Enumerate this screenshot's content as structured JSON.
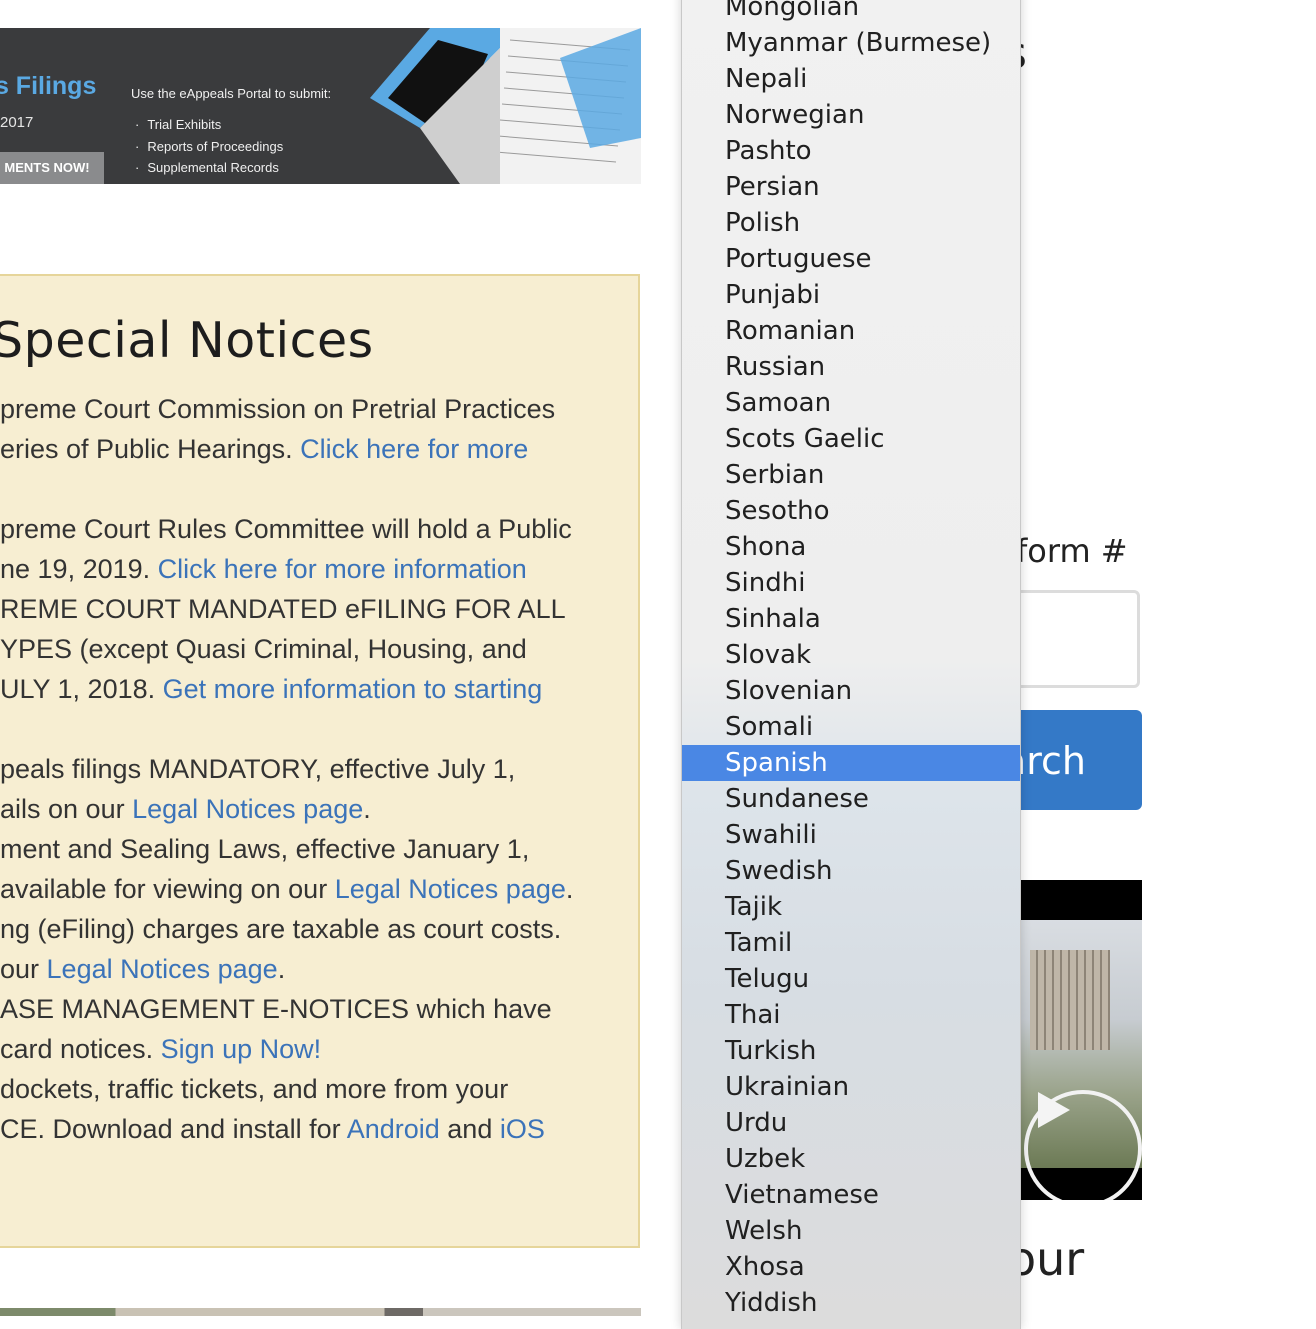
{
  "banner": {
    "title": "ls Filings",
    "year": "2017",
    "cta": "MENTS NOW!",
    "intro": "Use the eAppeals Portal to submit:",
    "items": [
      "Trial Exhibits",
      "Reports of Proceedings",
      "Supplemental Records"
    ]
  },
  "notices": {
    "heading": "Special Notices",
    "lines": [
      {
        "text": "preme Court Commission on Pretrial Practices",
        "link": ""
      },
      {
        "text": "eries of Public Hearings. ",
        "link": "Click here for more"
      },
      {
        "text": "preme Court Rules Committee will hold a Public",
        "link": ""
      },
      {
        "text": "ne 19, 2019. ",
        "link": "Click here for more information"
      },
      {
        "text": "REME COURT MANDATED eFILING FOR ALL",
        "link": ""
      },
      {
        "text": "YPES (except Quasi Criminal, Housing, and",
        "link": ""
      },
      {
        "text": "ULY 1, 2018. ",
        "link": "Get more information to starting"
      },
      {
        "text": "peals filings MANDATORY, effective July 1,",
        "link": ""
      },
      {
        "text": "ails on our ",
        "link": "Legal Notices page",
        "after": "."
      },
      {
        "text": "ment and Sealing Laws, effective January 1,",
        "link": ""
      },
      {
        "text": "available for viewing on our ",
        "link": "Legal Notices page",
        "after": "."
      },
      {
        "text": "ng (eFiling) charges are taxable as court costs.",
        "link": ""
      },
      {
        "text": " our ",
        "link": "Legal Notices page",
        "after": "."
      },
      {
        "text": "ASE MANAGEMENT E-NOTICES which have",
        "link": ""
      },
      {
        "text": "card notices. ",
        "link": "Sign up Now!"
      },
      {
        "text": "dockets, traffic tickets, and more from your",
        "link": ""
      },
      {
        "text": "CE. Download and install for ",
        "link": "Android",
        "mid": " and ",
        "link2": "iOS"
      }
    ]
  },
  "right": {
    "heading_fragment": "s",
    "form_label": "form #",
    "search_label": "arch",
    "bottom_fragment": "our"
  },
  "dropdown": {
    "selected": "Spanish",
    "options": [
      "Mongolian",
      "Myanmar (Burmese)",
      "Nepali",
      "Norwegian",
      "Pashto",
      "Persian",
      "Polish",
      "Portuguese",
      "Punjabi",
      "Romanian",
      "Russian",
      "Samoan",
      "Scots Gaelic",
      "Serbian",
      "Sesotho",
      "Shona",
      "Sindhi",
      "Sinhala",
      "Slovak",
      "Slovenian",
      "Somali",
      "Spanish",
      "Sundanese",
      "Swahili",
      "Swedish",
      "Tajik",
      "Tamil",
      "Telugu",
      "Thai",
      "Turkish",
      "Ukrainian",
      "Urdu",
      "Uzbek",
      "Vietnamese",
      "Welsh",
      "Xhosa",
      "Yiddish"
    ]
  },
  "colors": {
    "link": "#3b73b9",
    "notice_bg": "#f7eed2",
    "selected_bg": "#4a87e4",
    "search_bg": "#3479c7"
  }
}
